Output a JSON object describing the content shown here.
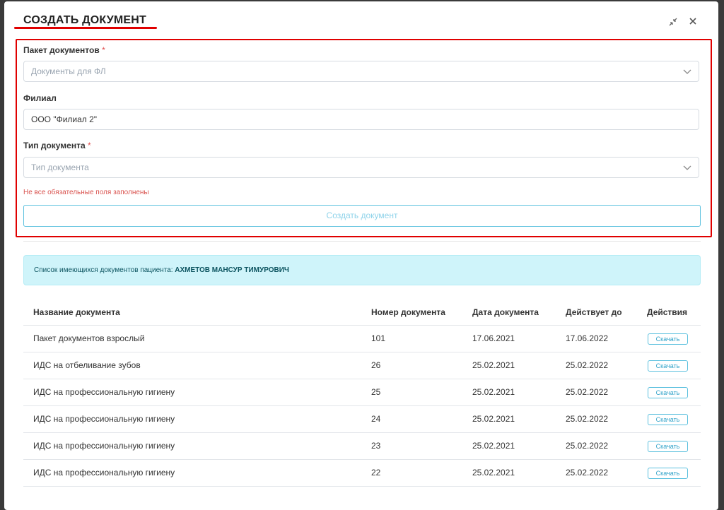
{
  "modal": {
    "title": "СОЗДАТЬ ДОКУМЕНТ",
    "collapse_icon": "collapse-arrows-icon",
    "close_icon": "close-icon"
  },
  "form": {
    "package": {
      "label": "Пакет документов",
      "required_mark": "*",
      "value": "Документы для ФЛ"
    },
    "branch": {
      "label": "Филиал",
      "value": "ООО \"Филиал 2\""
    },
    "doc_type": {
      "label": "Тип документа",
      "required_mark": "*",
      "placeholder": "Тип документа"
    },
    "error_text": "Не все обязательные поля заполнены",
    "create_button": "Создать документ"
  },
  "info": {
    "prefix": "Список имеющихся документов пациента: ",
    "patient": "АХМЕТОВ МАНСУР ТИМУРОВИЧ"
  },
  "table": {
    "headers": [
      "Название документа",
      "Номер документа",
      "Дата документа",
      "Действует до",
      "Действия"
    ],
    "rows": [
      {
        "name": "Пакет документов взрослый",
        "number": "101",
        "date": "17.06.2021",
        "valid": "17.06.2022",
        "action": "Скачать"
      },
      {
        "name": "ИДС на отбеливание зубов",
        "number": "26",
        "date": "25.02.2021",
        "valid": "25.02.2022",
        "action": "Скачать"
      },
      {
        "name": "ИДС на профессиональную гигиену",
        "number": "25",
        "date": "25.02.2021",
        "valid": "25.02.2022",
        "action": "Скачать"
      },
      {
        "name": "ИДС на профессиональную гигиену",
        "number": "24",
        "date": "25.02.2021",
        "valid": "25.02.2022",
        "action": "Скачать"
      },
      {
        "name": "ИДС на профессиональную гигиену",
        "number": "23",
        "date": "25.02.2021",
        "valid": "25.02.2022",
        "action": "Скачать"
      },
      {
        "name": "ИДС на профессиональную гигиену",
        "number": "22",
        "date": "25.02.2021",
        "valid": "25.02.2022",
        "action": "Скачать"
      }
    ]
  },
  "colors": {
    "accent": "#5bc0de",
    "error": "#d9534f",
    "highlight": "#e00000",
    "info_bg": "#cff4fa"
  }
}
